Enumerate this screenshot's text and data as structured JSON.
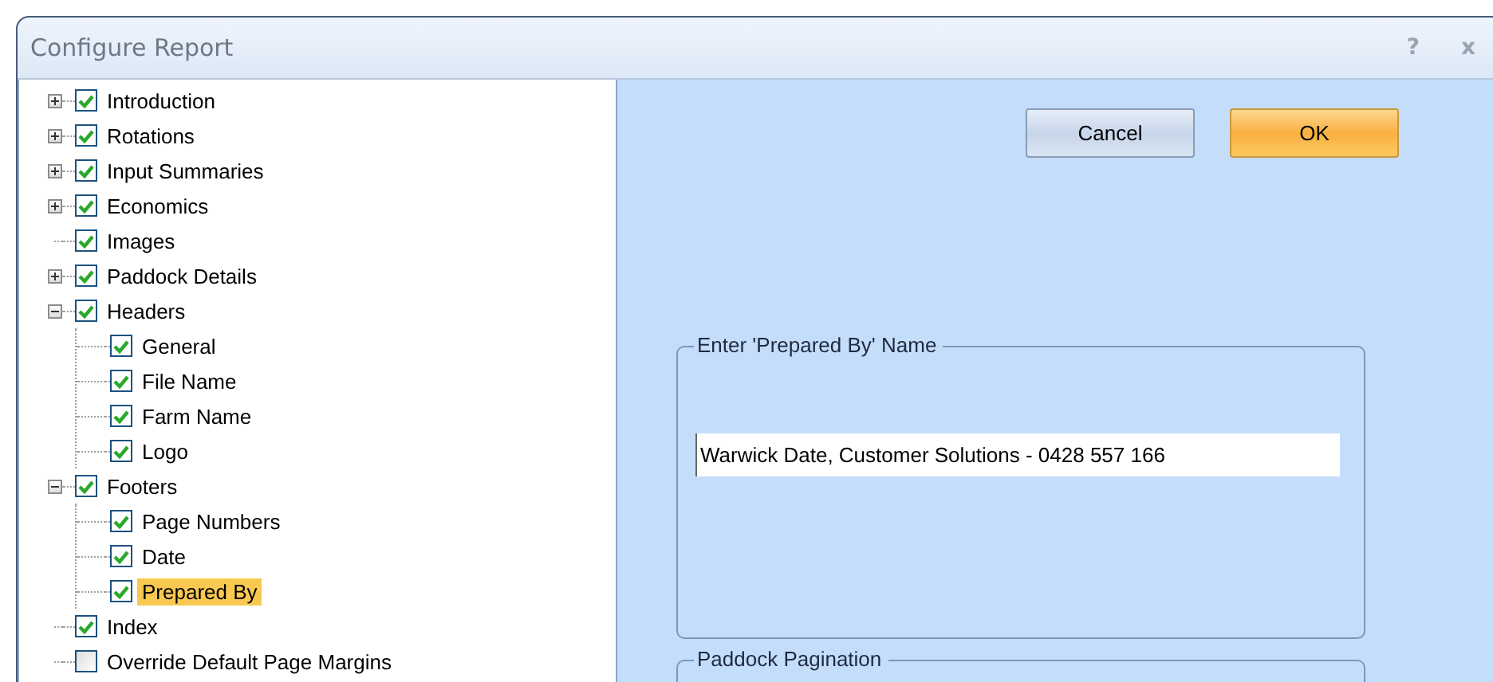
{
  "window": {
    "title": "Configure Report",
    "help_glyph": "?",
    "close_glyph": "x"
  },
  "tree": [
    {
      "label": "Introduction",
      "checked": true,
      "selected": false,
      "expanded": false
    },
    {
      "label": "Rotations",
      "checked": true,
      "selected": false,
      "expanded": false
    },
    {
      "label": "Input Summaries",
      "checked": true,
      "selected": false,
      "expanded": false
    },
    {
      "label": "Economics",
      "checked": true,
      "selected": false,
      "expanded": false
    },
    {
      "label": "Images",
      "checked": true,
      "selected": false
    },
    {
      "label": "Paddock Details",
      "checked": true,
      "selected": false,
      "expanded": false
    },
    {
      "label": "Headers",
      "checked": true,
      "selected": false,
      "expanded": true,
      "children": [
        {
          "label": "General",
          "checked": true,
          "selected": false
        },
        {
          "label": "File Name",
          "checked": true,
          "selected": false
        },
        {
          "label": "Farm Name",
          "checked": true,
          "selected": false
        },
        {
          "label": "Logo",
          "checked": true,
          "selected": false
        }
      ]
    },
    {
      "label": "Footers",
      "checked": true,
      "selected": false,
      "expanded": true,
      "children": [
        {
          "label": "Page Numbers",
          "checked": true,
          "selected": false
        },
        {
          "label": "Date",
          "checked": true,
          "selected": false
        },
        {
          "label": "Prepared By",
          "checked": true,
          "selected": true
        }
      ]
    },
    {
      "label": "Index",
      "checked": true,
      "selected": false
    },
    {
      "label": "Override Default Page Margins",
      "checked": false,
      "selected": false
    }
  ],
  "buttons": [
    {
      "label": "Cancel",
      "kind": "normal"
    },
    {
      "label": "OK",
      "kind": "default"
    }
  ],
  "prepared_by": {
    "legend": "Enter 'Prepared By' Name",
    "value": "Warwick Date, Customer Solutions - 0428 557 166"
  },
  "pagination": {
    "legend": "Paddock Pagination"
  }
}
